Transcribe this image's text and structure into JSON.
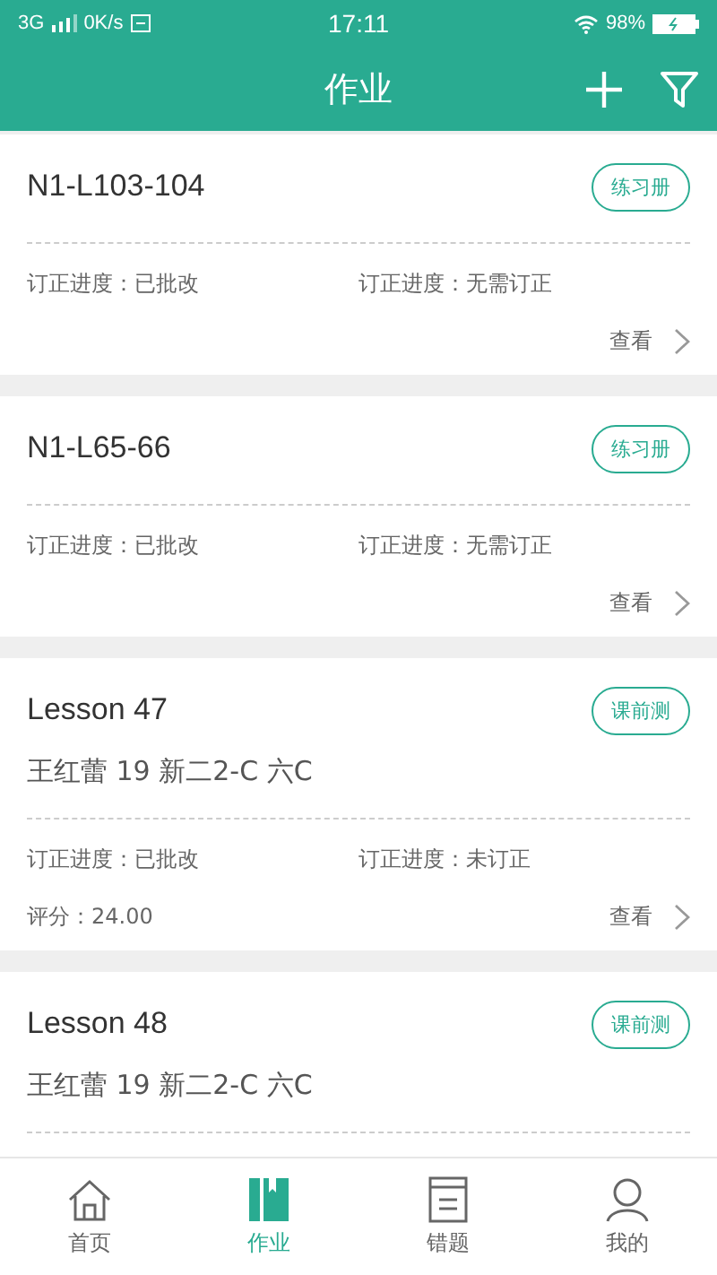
{
  "status_bar": {
    "network": "3G",
    "speed": "0K/s",
    "time": "17:11",
    "battery": "98%"
  },
  "header": {
    "title": "作业"
  },
  "cards": [
    {
      "title": "N1-L103-104",
      "tag": "练习册",
      "progress": [
        "订正进度：已批改",
        "订正进度：无需订正"
      ],
      "view": "查看"
    },
    {
      "title": "N1-L65-66",
      "tag": "练习册",
      "progress": [
        "订正进度：已批改",
        "订正进度：无需订正"
      ],
      "view": "查看"
    },
    {
      "title": "Lesson 47",
      "tag": "课前测",
      "subtitle": "王红蕾 19 新二2-C 六C",
      "progress": [
        "订正进度：已批改",
        "订正进度：未订正"
      ],
      "score": "评分：24.00",
      "view": "查看"
    },
    {
      "title": "Lesson 48",
      "tag": "课前测",
      "subtitle": "王红蕾 19 新二2-C 六C"
    }
  ],
  "nav": [
    {
      "label": "首页",
      "kind": "home",
      "selected": false
    },
    {
      "label": "作业",
      "kind": "homework",
      "selected": true
    },
    {
      "label": "错题",
      "kind": "mistakes",
      "selected": false
    },
    {
      "label": "我的",
      "kind": "profile",
      "selected": false
    }
  ]
}
